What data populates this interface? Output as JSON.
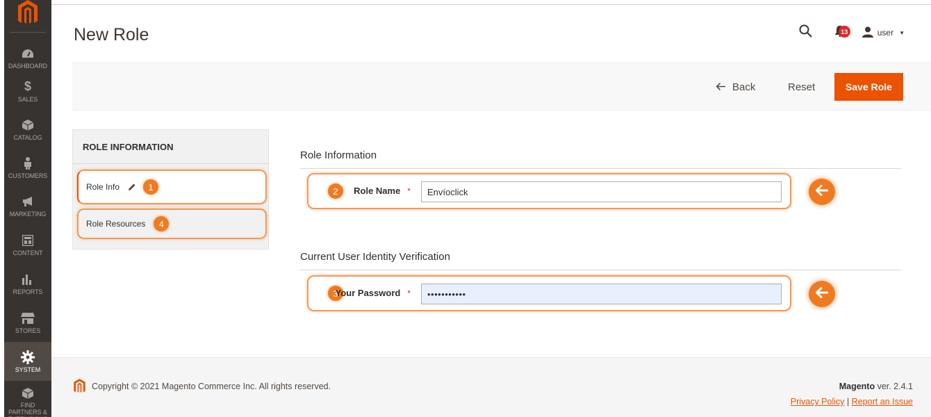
{
  "sidebar": {
    "items": [
      {
        "label": "DASHBOARD",
        "icon": "dashboard-gauge-icon"
      },
      {
        "label": "SALES",
        "icon": "dollar-icon"
      },
      {
        "label": "CATALOG",
        "icon": "box-icon"
      },
      {
        "label": "CUSTOMERS",
        "icon": "person-icon"
      },
      {
        "label": "MARKETING",
        "icon": "megaphone-icon"
      },
      {
        "label": "CONTENT",
        "icon": "layout-icon"
      },
      {
        "label": "REPORTS",
        "icon": "bar-chart-icon"
      },
      {
        "label": "STORES",
        "icon": "storefront-icon"
      },
      {
        "label": "SYSTEM",
        "icon": "gear-icon"
      },
      {
        "label": "FIND PARTNERS & EXTENSIONS",
        "icon": "cube-icon"
      }
    ],
    "active_index": 8
  },
  "header": {
    "title": "New Role",
    "notifications_count": "13",
    "user_name": "user"
  },
  "actions": {
    "back_label": "Back",
    "reset_label": "Reset",
    "save_label": "Save Role"
  },
  "tabs": {
    "title": "ROLE INFORMATION",
    "items": [
      {
        "label": "Role Info",
        "badge": "1"
      },
      {
        "label": "Role Resources",
        "badge": "4"
      }
    ]
  },
  "role_information": {
    "section_title": "Role Information",
    "role_name_label": "Role Name",
    "role_name_value": "Envíoclick",
    "badge": "2"
  },
  "verification": {
    "section_title": "Current User Identity Verification",
    "password_label": "Your Password",
    "password_value": "•••••••••••",
    "badge": "3"
  },
  "required_marker": "*",
  "footer": {
    "copyright": "Copyright © 2021 Magento Commerce Inc. All rights reserved.",
    "brand": "Magento",
    "version": " ver. 2.4.1",
    "privacy_link": "Privacy Policy",
    "separator": "|",
    "report_link": "Report an Issue"
  },
  "colors": {
    "accent": "#eb5202",
    "highlight": "#f07a20",
    "sidebar_bg": "#373330",
    "badge_red": "#e22626"
  }
}
